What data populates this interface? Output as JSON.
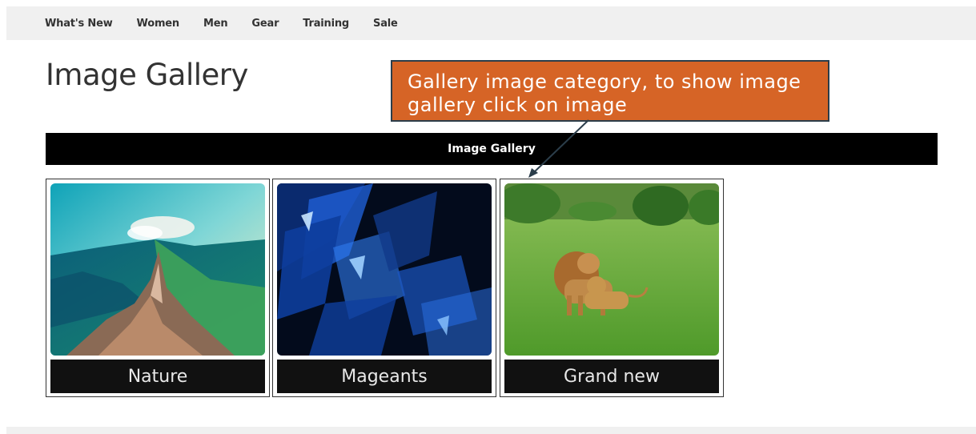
{
  "nav": {
    "items": [
      {
        "label": "What's New"
      },
      {
        "label": "Women"
      },
      {
        "label": "Men"
      },
      {
        "label": "Gear"
      },
      {
        "label": "Training"
      },
      {
        "label": "Sale"
      }
    ]
  },
  "page": {
    "title": "Image Gallery",
    "gallery_header": "Image Gallery"
  },
  "gallery": {
    "categories": [
      {
        "caption": "Nature",
        "image": "mountain-ridge-image"
      },
      {
        "caption": "Mageants",
        "image": "blue-abstract-shards-image"
      },
      {
        "caption": "Grand new",
        "image": "lions-in-grass-image"
      }
    ]
  },
  "annotation": {
    "text_line1": "Gallery image category, to show image",
    "text_line2": "gallery click on image",
    "color": "#d66426",
    "border_color": "#2b3d4a"
  },
  "colors": {
    "topbar_bg": "#f0f0f0",
    "header_bar_bg": "#000000",
    "caption_bg": "#111111"
  }
}
